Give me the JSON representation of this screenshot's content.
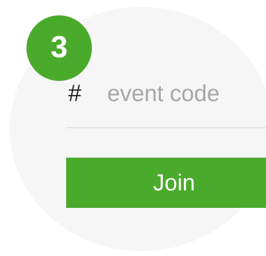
{
  "step": {
    "number": "3"
  },
  "event_code": {
    "placeholder": "event code",
    "value": "",
    "icon": "hash-icon",
    "icon_glyph": "#"
  },
  "actions": {
    "join_label": "Join"
  },
  "colors": {
    "accent": "#4aaa2b",
    "placeholder": "#a7a7a7",
    "background": "#f6f6f6"
  }
}
